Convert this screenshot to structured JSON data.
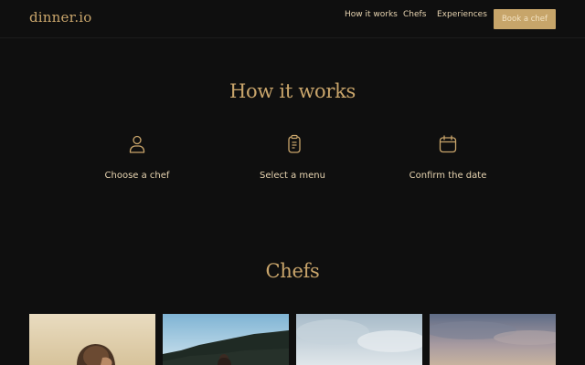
{
  "header": {
    "logo": "dinner.io",
    "nav": [
      "How it works",
      "Chefs",
      "Experiences"
    ],
    "cta": "Book a chef"
  },
  "how_it_works": {
    "title": "How it works",
    "steps": [
      {
        "label": "Choose a chef",
        "icon": "user-icon"
      },
      {
        "label": "Select a menu",
        "icon": "clipboard-icon"
      },
      {
        "label": "Confirm the date",
        "icon": "calendar-icon"
      }
    ]
  },
  "chefs": {
    "title": "Chefs",
    "cards": [
      {
        "image": "chef-photo-1"
      },
      {
        "image": "chef-photo-2"
      },
      {
        "image": "chef-photo-3"
      },
      {
        "image": "chef-photo-4"
      }
    ]
  },
  "colors": {
    "background": "#0f0f0f",
    "accent": "#c9a56b",
    "text": "#e6d3b0"
  }
}
